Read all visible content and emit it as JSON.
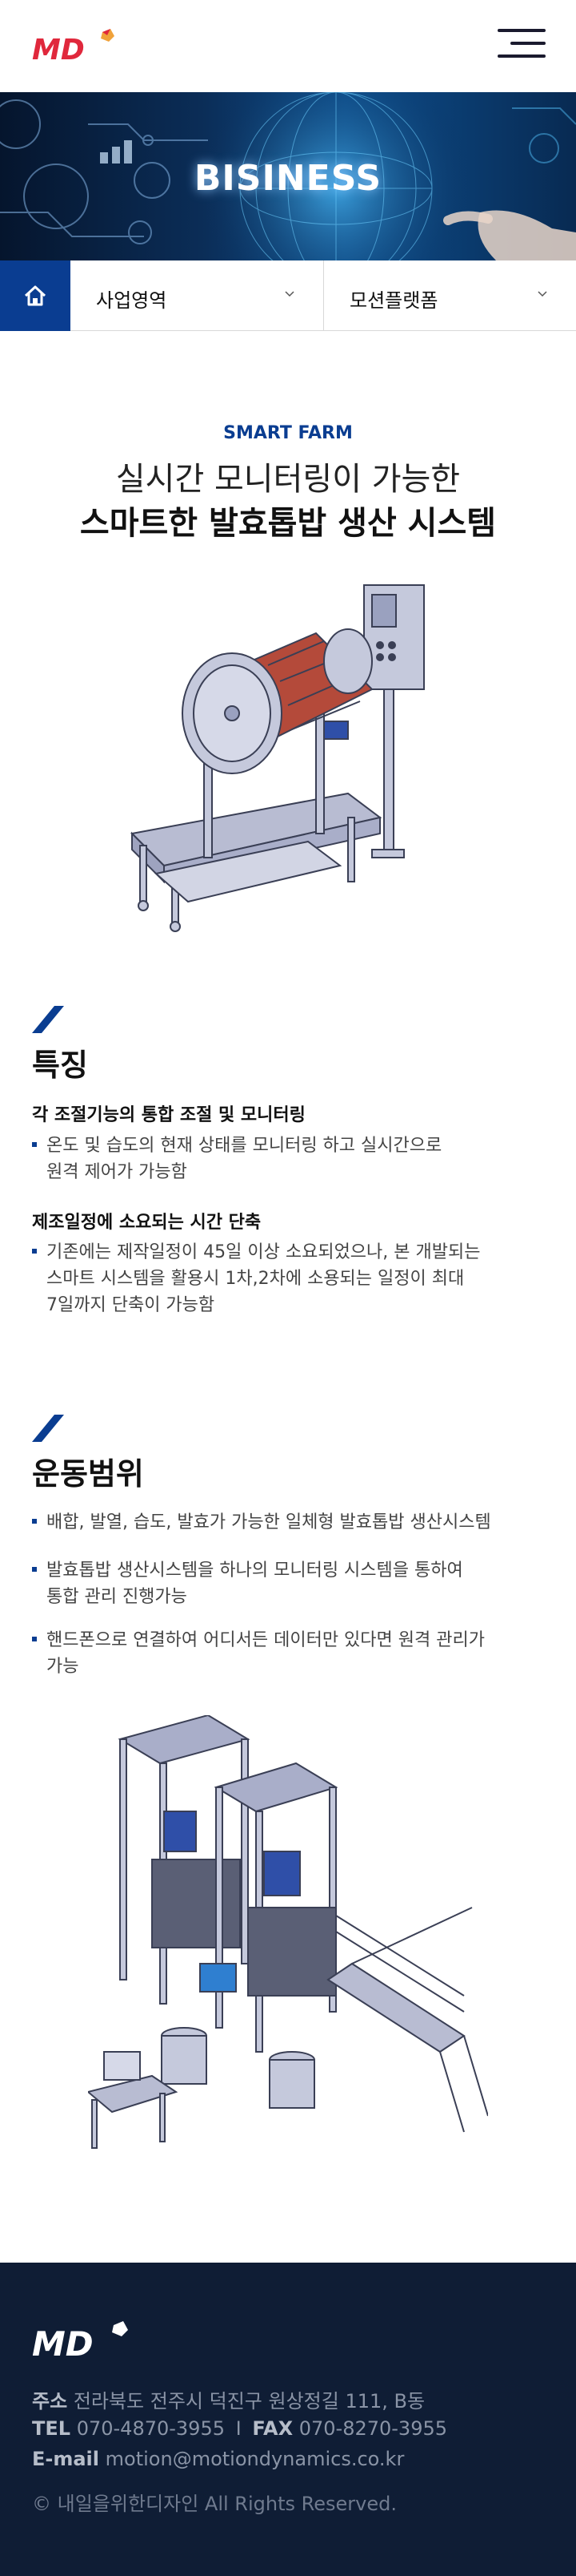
{
  "header": {
    "logo_text": "MD",
    "menu_icon": "hamburger-menu-icon"
  },
  "hero": {
    "title": "BISINESS"
  },
  "subnav": {
    "home_icon": "home-icon",
    "dropdown1": "사업영역",
    "dropdown2": "모션플랫폼"
  },
  "intro": {
    "kicker": "SMART FARM",
    "headline1": "실시간 모니터링이 가능한",
    "headline2": "스마트한 발효톱밥 생산 시스템"
  },
  "features": {
    "title": "특징",
    "items": [
      {
        "subtitle": "각 조절기능의 통합 조절 및 모니터링",
        "lines": [
          "온도 및 습도의 현재 상태를 모니터링 하고 실시간으로",
          "원격 제어가 가능함"
        ]
      },
      {
        "subtitle": "제조일정에 소요되는 시간 단축",
        "lines": [
          "기존에는 제작일정이 45일 이상 소요되었으나, 본 개발되는",
          "스마트 시스템을 활용시 1차,2차에 소용되는 일정이 최대",
          "7일까지 단축이 가능함"
        ]
      }
    ]
  },
  "scope": {
    "title": "운동범위",
    "items": [
      [
        "배합, 발열, 습도, 발효가 가능한 일체형 발효톱밥 생산시스템"
      ],
      [
        "발효톱밥 생산시스템을 하나의 모니터링 시스템을 통하여",
        "통합 관리 진행가능"
      ],
      [
        "핸드폰으로 연결하여 어디서든 데이터만 있다면 원격 관리가",
        "가능"
      ]
    ]
  },
  "footer": {
    "address_label": "주소",
    "address": "전라북도 전주시 덕진구 원상정길 111, B동",
    "tel_label": "TEL",
    "tel": "070-4870-3955",
    "separator": "I",
    "fax_label": "FAX",
    "fax": "070-8270-3955",
    "email_label": "E-mail",
    "email": "motion@motiondynamics.co.kr",
    "copyright": "© 내일을위한디자인  All Rights Reserved."
  },
  "colors": {
    "brand_blue": "#0a3d91",
    "logo_red": "#e0283c",
    "footer_bg": "#0f1d35"
  }
}
